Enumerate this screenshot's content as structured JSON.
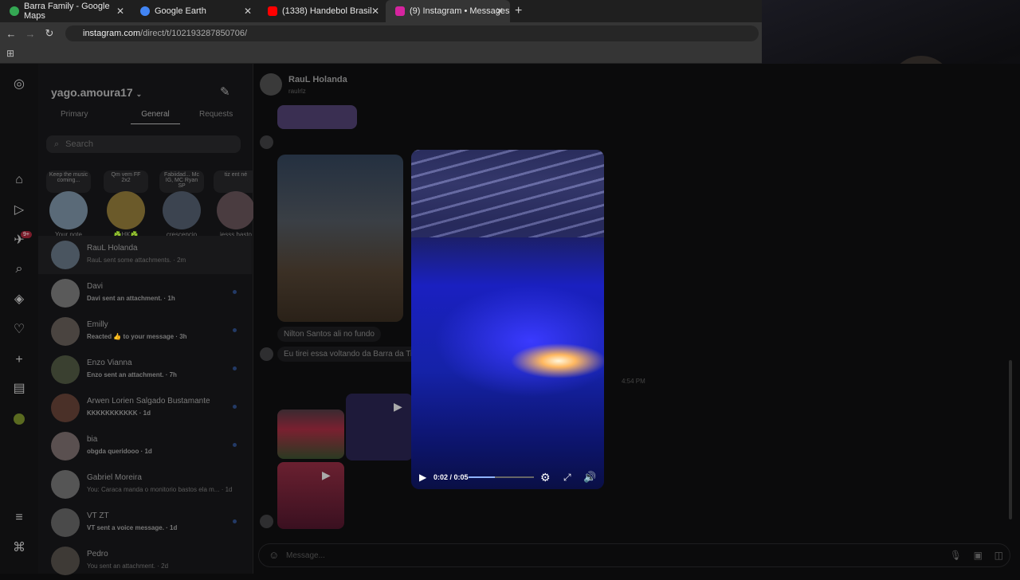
{
  "browser": {
    "tabs": [
      {
        "title": "Barra Family - Google Maps",
        "color": "#34a853"
      },
      {
        "title": "Google Earth",
        "color": "#4285f4"
      },
      {
        "title": "(1338) Handebol Brasil x Espanh",
        "color": "#ff0000"
      },
      {
        "title": "(9) Instagram • Messages",
        "color": "#d6249f"
      }
    ],
    "url_domain": "instagram.com",
    "url_path": "/direct/t/102193287850706/"
  },
  "sidebar": {
    "username": "yago.amoura17",
    "tabs": [
      "Primary",
      "General",
      "Requests"
    ],
    "search_placeholder": "Search",
    "badge": "9+",
    "notes": [
      {
        "bubble": "Keep the music coming...",
        "label": "Your note"
      },
      {
        "bubble": "Qm vem FF 2x2",
        "label": "☘️HK☘️"
      },
      {
        "bubble": "Fabiidad... Mc IG, MC Ryan SP",
        "label": "crescencio"
      },
      {
        "bubble": "tiz ent né",
        "label": "jesss.basto"
      }
    ],
    "conversations": [
      {
        "name": "RauL Holanda",
        "preview": "RauL sent some attachments.",
        "time": "· 2m",
        "bold": false
      },
      {
        "name": "Davi",
        "preview": "Davi sent an attachment.",
        "time": "· 1h",
        "bold": true
      },
      {
        "name": "Emilly",
        "preview": "Reacted 👍 to your message",
        "time": "· 3h",
        "bold": true
      },
      {
        "name": "Enzo Vianna",
        "preview": "Enzo sent an attachment.",
        "time": "· 7h",
        "bold": true
      },
      {
        "name": "Arwen Lorien Salgado Bustamante",
        "preview": "KKKKKKKKKKK",
        "time": "· 1d",
        "bold": true
      },
      {
        "name": "bia",
        "preview": "obgda queridooo",
        "time": "· 1d",
        "bold": true
      },
      {
        "name": "Gabriel Moreira",
        "preview": "You: Caraca manda o monitorio bastos ela m...",
        "time": "· 1d",
        "bold": false
      },
      {
        "name": "VT ZT",
        "preview": "VT sent a voice message.",
        "time": "· 1d",
        "bold": true
      },
      {
        "name": "Pedro",
        "preview": "You sent an attachment.",
        "time": "· 2d",
        "bold": false
      }
    ]
  },
  "chat": {
    "name": "RauL Holanda",
    "username": "raulrlz",
    "msg1": "Nilton Santos ali no fundo",
    "msg2": "Eu tirei essa voltando da Barra da Tij",
    "timestamp": "4:54 PM",
    "message_placeholder": "Message..."
  },
  "video": {
    "time": "0:02 / 0:05",
    "progress": 0.4
  }
}
